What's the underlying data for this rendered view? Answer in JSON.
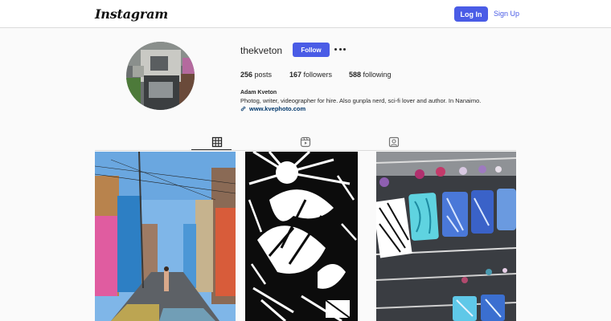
{
  "header": {
    "logo_text": "Instagram",
    "login_label": "Log In",
    "signup_label": "Sign Up"
  },
  "profile": {
    "username": "thekveton",
    "follow_label": "Follow",
    "posts_count": "256",
    "posts_label": "posts",
    "followers_count": "167",
    "followers_label": "followers",
    "following_count": "588",
    "following_label": "following",
    "full_name": "Adam Kveton",
    "bio": "Photog, writer, videographer for hire. Also gunpla nerd, sci-fi lover and author. In Nanaimo.",
    "website": "www.kvephoto.com"
  },
  "tabs": [
    {
      "icon": "grid-icon",
      "active": true
    },
    {
      "icon": "reels-icon",
      "active": false
    },
    {
      "icon": "tagged-icon",
      "active": false
    }
  ],
  "posts": [
    {
      "icon": "alley-street-photo"
    },
    {
      "icon": "heron-papercut-art"
    },
    {
      "icon": "earrings-display-photo"
    }
  ],
  "colors": {
    "accent": "#4a5ce6",
    "link": "#00376b",
    "border": "#dbdbdb",
    "background": "#fafafa"
  }
}
